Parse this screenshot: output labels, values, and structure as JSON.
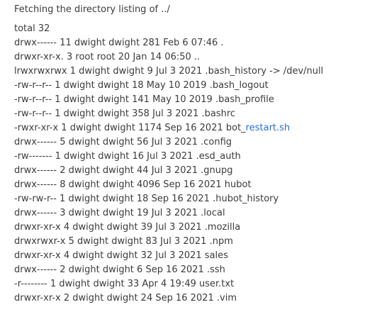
{
  "header": {
    "status": "Fetching the directory listing of ../"
  },
  "listing": {
    "total": "total 32",
    "lines": [
      "drwx------ 11 dwight dwight 281 Feb 6 07:46 .",
      "drwxr-xr-x. 3 root root 20 Jan 14 06:50 ..",
      "lrwxrwxrwx 1 dwight dwight 9 Jul 3 2021 .bash_history -> /dev/null",
      "-rw-r--r-- 1 dwight dwight 18 May 10 2019 .bash_logout",
      "-rw-r--r-- 1 dwight dwight 141 May 10 2019 .bash_profile",
      "-rw-r--r-- 1 dwight dwight 358 Jul 3 2021 .bashrc",
      "-rwxr-xr-x 1 dwight dwight 1174 Sep 16 2021 bot_",
      "drwx------ 5 dwight dwight 56 Jul 3 2021 .config",
      "-rw------- 1 dwight dwight 16 Jul 3 2021 .esd_auth",
      "drwx------ 2 dwight dwight 44 Jul 3 2021 .gnupg",
      "drwx------ 8 dwight dwight 4096 Sep 16 2021 hubot",
      "-rw-rw-r-- 1 dwight dwight 18 Sep 16 2021 .hubot_history",
      "drwx------ 3 dwight dwight 19 Jul 3 2021 .local",
      "drwxr-xr-x 4 dwight dwight 39 Jul 3 2021 .mozilla",
      "drwxrwxr-x 5 dwight dwight 83 Jul 3 2021 .npm",
      "drwxr-xr-x 4 dwight dwight 32 Jul 3 2021 sales",
      "drwx------ 2 dwight dwight 6 Sep 16 2021 .ssh",
      "-r-------- 1 dwight dwight 33 Apr 4 19:49 user.txt",
      "drwxr-xr-x 2 dwight dwight 24 Sep 16 2021 .vim"
    ],
    "link_text": "restart.sh"
  },
  "colors": {
    "text": "#3b3b3b",
    "link": "#2a6fd1",
    "background": "#ffffff"
  }
}
